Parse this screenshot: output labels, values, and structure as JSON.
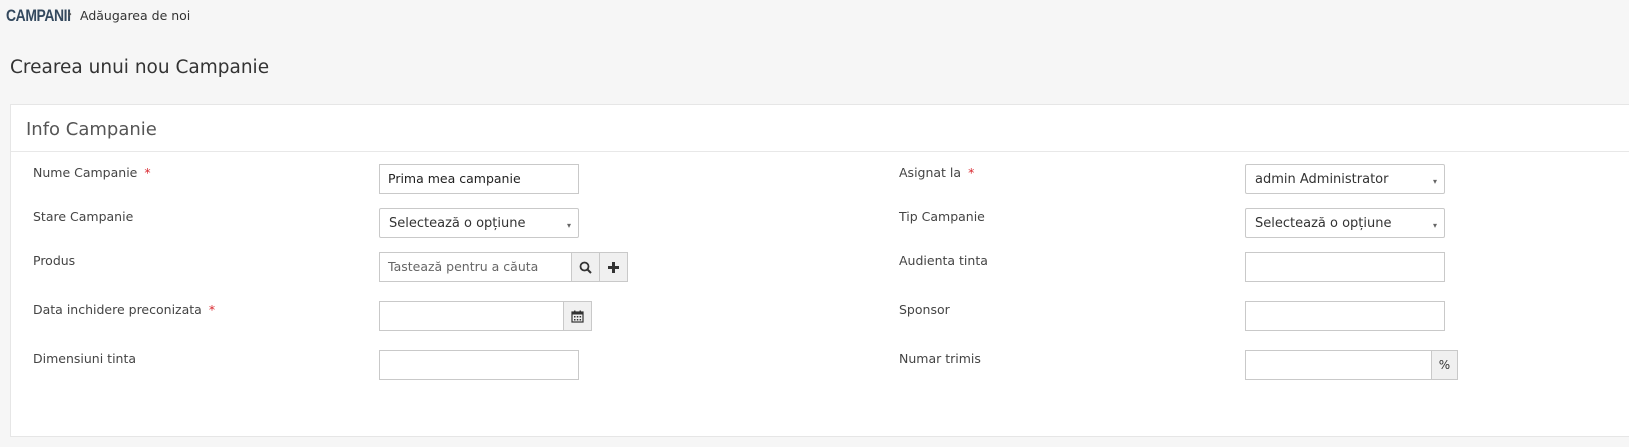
{
  "breadcrumb": {
    "module": "CAMPANII",
    "separator": "›",
    "page": "Adăugarea de noi"
  },
  "page_title": "Crearea unui nou Campanie",
  "panel": {
    "title": "Info Campanie"
  },
  "fields": {
    "nume_campanie": {
      "label": "Nume Campanie",
      "required": "*",
      "value": "Prima mea campanie"
    },
    "stare_campanie": {
      "label": "Stare Campanie",
      "value": "Selectează o opțiune"
    },
    "produs": {
      "label": "Produs",
      "placeholder": "Tastează pentru a căuta"
    },
    "data_inchidere": {
      "label": "Data inchidere preconizata",
      "required": "*",
      "value": ""
    },
    "dimensiuni_tinta": {
      "label": "Dimensiuni tinta",
      "value": ""
    },
    "asignat_la": {
      "label": "Asignat la",
      "required": "*",
      "value": "admin Administrator"
    },
    "tip_campanie": {
      "label": "Tip Campanie",
      "value": "Selectează o opțiune"
    },
    "audienta_tinta": {
      "label": "Audienta tinta",
      "value": ""
    },
    "sponsor": {
      "label": "Sponsor",
      "value": ""
    },
    "numar_trimis": {
      "label": "Numar trimis",
      "value": "",
      "suffix": "%"
    }
  },
  "icons": {
    "select_arrow": "▾",
    "search": "search-icon",
    "add": "plus-icon",
    "calendar": "calendar-icon"
  },
  "colors": {
    "required": "#d9282f",
    "module": "#34495e"
  }
}
